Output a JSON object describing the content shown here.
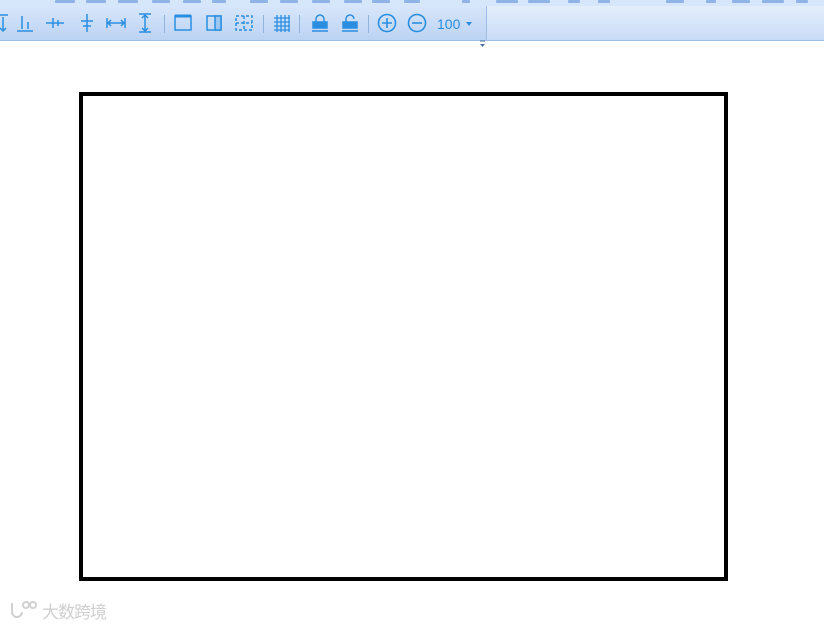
{
  "toolbar": {
    "icons": [
      "align-top-icon",
      "align-bottom-icon",
      "align-vertical-center-icon",
      "align-horizontal-center-icon",
      "same-width-icon",
      "same-height-icon",
      "frame-icon",
      "half-frame-icon",
      "dashed-frame-icon",
      "grid-icon",
      "lock-icon",
      "unlock-icon",
      "zoom-in-icon",
      "zoom-out-icon"
    ],
    "zoom_value": "100",
    "accent_color": "#2a8ee0"
  },
  "watermark": {
    "text": "大数跨境"
  }
}
